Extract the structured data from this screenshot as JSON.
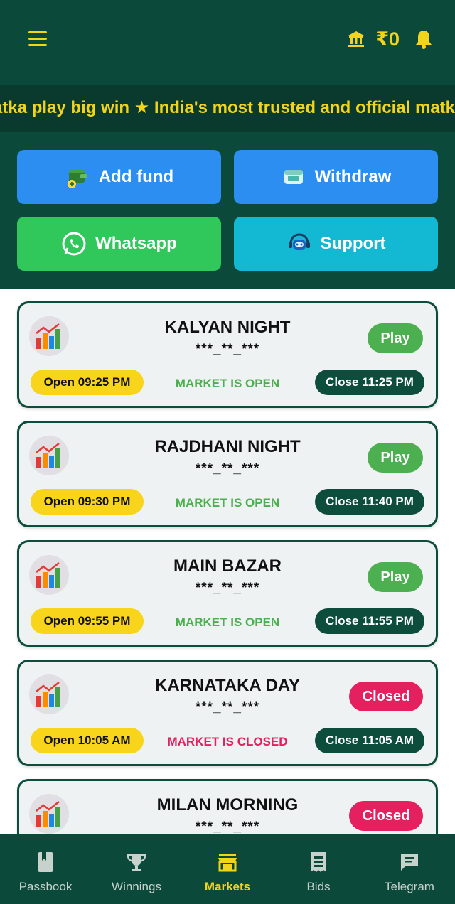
{
  "header": {
    "wallet_amount": "₹0",
    "marquee_text": "atka play big win ★ India's most trusted and official matk"
  },
  "actions": {
    "add_fund": "Add fund",
    "withdraw": "Withdraw",
    "whatsapp": "Whatsapp",
    "support": "Support"
  },
  "markets": [
    {
      "name": "KALYAN NIGHT",
      "result": "***_**_***",
      "button": "Play",
      "status": "MARKET IS OPEN",
      "open": "Open 09:25 PM",
      "close": "Close 11:25 PM"
    },
    {
      "name": "RAJDHANI NIGHT",
      "result": "***_**_***",
      "button": "Play",
      "status": "MARKET IS OPEN",
      "open": "Open 09:30 PM",
      "close": "Close 11:40 PM"
    },
    {
      "name": "MAIN BAZAR",
      "result": "***_**_***",
      "button": "Play",
      "status": "MARKET IS OPEN",
      "open": "Open 09:55 PM",
      "close": "Close 11:55 PM"
    },
    {
      "name": "KARNATAKA DAY",
      "result": "***_**_***",
      "button": "Closed",
      "status": "MARKET IS CLOSED",
      "open": "Open 10:05 AM",
      "close": "Close 11:05 AM"
    },
    {
      "name": "MILAN MORNING",
      "result": "***_**_***",
      "button": "Closed",
      "status": "",
      "open": "",
      "close": ""
    }
  ],
  "nav": {
    "items": [
      {
        "label": "Passbook",
        "icon": "passbook-icon"
      },
      {
        "label": "Winnings",
        "icon": "trophy-icon"
      },
      {
        "label": "Markets",
        "icon": "store-icon"
      },
      {
        "label": "Bids",
        "icon": "receipt-icon"
      },
      {
        "label": "Telegram",
        "icon": "chat-icon"
      }
    ],
    "active": "Markets"
  },
  "colors": {
    "header_bg": "#0b4a3a",
    "accent_yellow": "#f2d51a",
    "play_green": "#4caf50",
    "closed_red": "#e4205e",
    "button_blue": "#2b8ef0",
    "whatsapp_green": "#30c85b",
    "support_cyan": "#13b8d3"
  }
}
